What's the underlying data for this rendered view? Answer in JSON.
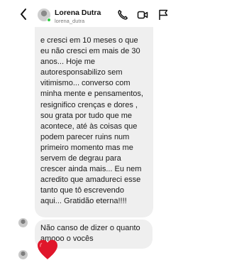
{
  "header": {
    "name": "Lorena Dutra",
    "handle": "lorena_dutra",
    "icons": [
      "back-arrow-icon",
      "phone-icon",
      "video-call-icon",
      "flag-icon"
    ],
    "online_color": "#2ecc40"
  },
  "messages": [
    {
      "lines": [
        "e cresci em 10 meses o que",
        "eu não cresci em mais de 30",
        "anos... Hoje me",
        "autoresponsabilizo sem",
        "vitimismo... converso com",
        "minha mente e pensamentos,",
        "resignifico crenças e dores ,",
        "sou grata por tudo que me",
        "acontece, até às coisas que",
        "podem parecer ruins num",
        "primeiro momento mas me",
        "servem de degrau para",
        "crescer ainda mais... Eu nem",
        "acredito que amadureci esse",
        "tanto que tô escrevendo",
        "aqui... Gratidão eterna!!!!"
      ]
    },
    {
      "lines": [
        "Não canso de dizer o quanto",
        "amooo o vocês"
      ]
    },
    {
      "emoji": "red-heart-icon",
      "color": "#e0162b"
    }
  ]
}
